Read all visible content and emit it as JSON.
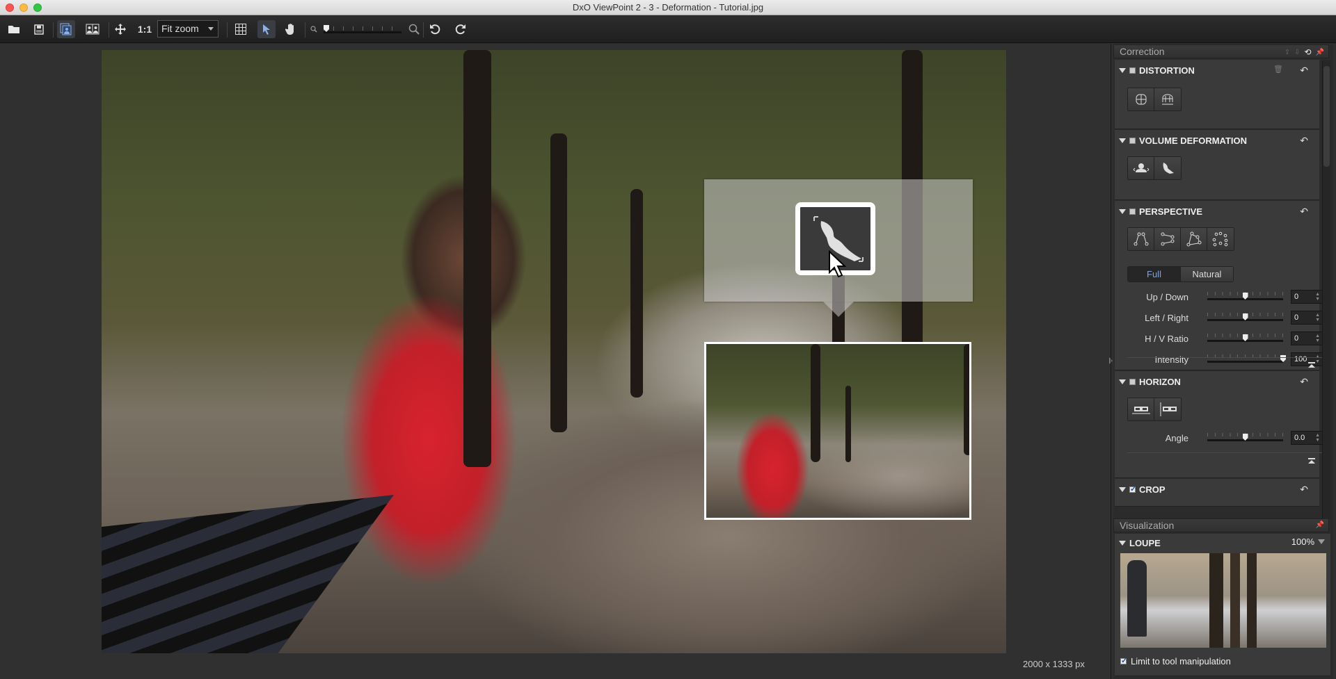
{
  "window": {
    "title": "DxO ViewPoint 2 - 3 - Deformation - Tutorial.jpg"
  },
  "toolbar": {
    "items": [
      {
        "name": "open",
        "icon": "folder-icon"
      },
      {
        "name": "save",
        "icon": "save-icon"
      },
      {
        "name": "single-view",
        "icon": "single-view-icon",
        "active": true
      },
      {
        "name": "compare-view",
        "icon": "compare-view-icon"
      },
      {
        "name": "fit",
        "icon": "move-icon"
      },
      {
        "name": "one-to-one",
        "label": "1:1"
      },
      {
        "name": "grid",
        "icon": "grid-icon"
      },
      {
        "name": "select-tool",
        "icon": "cursor-icon",
        "active": true
      },
      {
        "name": "hand-tool",
        "icon": "hand-icon"
      },
      {
        "name": "rotate-left",
        "icon": "rotate-left-icon"
      },
      {
        "name": "rotate-right",
        "icon": "rotate-right-icon"
      }
    ],
    "zoom_select": {
      "value": "Fit zoom"
    },
    "zoom_slider_fraction": 0.0
  },
  "canvas": {
    "image_size": "2000 x 1333 px",
    "hint": {
      "icon": "volume-deformation-diagonal-icon"
    }
  },
  "correction_panel": {
    "title": "Correction",
    "sections": {
      "distortion": {
        "label": "DISTORTION",
        "enabled": false,
        "tools": [
          "distortion-barrel-icon",
          "distortion-fisheye-icon"
        ]
      },
      "volume": {
        "label": "VOLUME DEFORMATION",
        "enabled": false,
        "tools": [
          "volume-horizontal-icon",
          "volume-diagonal-icon"
        ]
      },
      "perspective": {
        "label": "PERSPECTIVE",
        "enabled": false,
        "tools": [
          "perspective-vertical-icon",
          "perspective-horizontal-icon",
          "perspective-4point-icon",
          "perspective-8point-icon"
        ],
        "mode": {
          "options": [
            "Full",
            "Natural"
          ],
          "selected": "Full"
        },
        "sliders": [
          {
            "label": "Up / Down",
            "value": "0",
            "fraction": 0.5
          },
          {
            "label": "Left / Right",
            "value": "0",
            "fraction": 0.5
          },
          {
            "label": "H / V Ratio",
            "value": "0",
            "fraction": 0.5
          },
          {
            "label": "Intensity",
            "value": "100",
            "fraction": 1.0
          }
        ]
      },
      "horizon": {
        "label": "HORIZON",
        "enabled": false,
        "tools": [
          "horizon-level-icon",
          "horizon-vertical-icon"
        ],
        "sliders": [
          {
            "label": "Angle",
            "value": "0.0",
            "fraction": 0.5
          }
        ]
      },
      "crop": {
        "label": "CROP",
        "enabled": true
      }
    }
  },
  "visualization_panel": {
    "title": "Visualization",
    "loupe": {
      "label": "LOUPE",
      "zoom": "100%",
      "limit_label": "Limit to tool manipulation",
      "limit_checked": true
    }
  },
  "colors": {
    "accent": "#7fa2dd",
    "panel_bg": "#3a3a3a",
    "canvas_bg": "#303030"
  }
}
